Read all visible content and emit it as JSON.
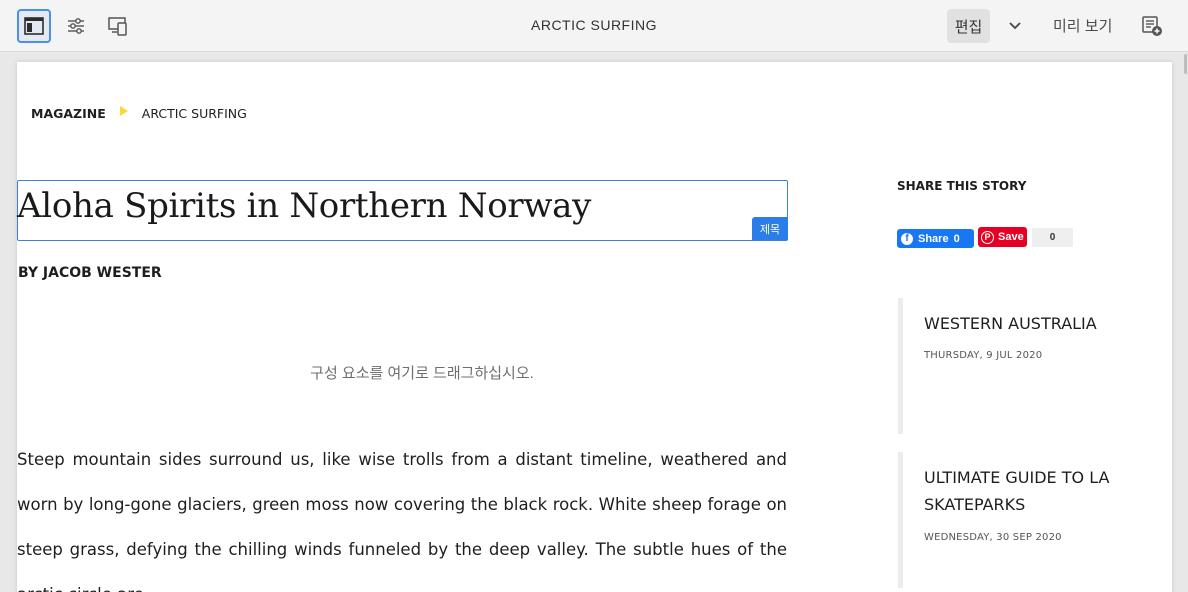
{
  "toolbar": {
    "page_title": "ARCTIC SURFING",
    "edit_label": "편집",
    "preview_label": "미리 보기"
  },
  "breadcrumb": {
    "items": [
      "MAGAZINE",
      "ARCTIC SURFING"
    ]
  },
  "article": {
    "title": "Aloha Spirits in Northern Norway",
    "title_component_tag": "제목",
    "byline": "BY JACOB WESTER",
    "dropzone_hint": "구성 요소를 여기로 드래그하십시오.",
    "body": "Steep mountain sides surround us, like wise trolls from a distant timeline, weathered and worn by long-gone glaciers, green moss now covering the black rock. White sheep forage on steep grass, defying the chilling winds funneled by the deep valley. The subtle hues of the arctic circle are ..."
  },
  "share": {
    "title": "SHARE THIS STORY",
    "facebook_label": "Share",
    "facebook_count": "0",
    "pinterest_label": "Save",
    "pinterest_count": "0"
  },
  "related": [
    {
      "title": "WESTERN AUSTRALIA",
      "date": "THURSDAY, 9 JUL 2020"
    },
    {
      "title": "ULTIMATE GUIDE TO LA SKATEPARKS",
      "date": "WEDNESDAY, 30 SEP 2020"
    }
  ],
  "colors": {
    "accent": "#2b7de9",
    "breadcrumb_arrow": "#f7d93a",
    "facebook": "#1877f2",
    "pinterest": "#e60023"
  }
}
